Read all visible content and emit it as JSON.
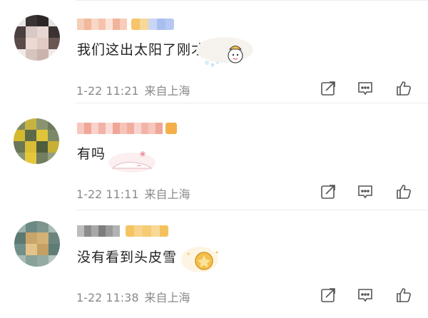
{
  "comments": [
    {
      "text": "我们这出太阳了刚才",
      "time": "1-22 11:21",
      "location": "来自上海"
    },
    {
      "text": "有吗",
      "time": "1-22 11:11",
      "location": "来自上海"
    },
    {
      "text": "没有看到头皮雪",
      "time": "1-22 11:38",
      "location": "来自上海"
    }
  ],
  "icons": {
    "share": "share-icon",
    "reply": "comment-icon",
    "like": "thumbs-up-icon"
  },
  "colors": {
    "text": "#222222",
    "meta": "#8a8a8a",
    "icon": "#555555"
  }
}
